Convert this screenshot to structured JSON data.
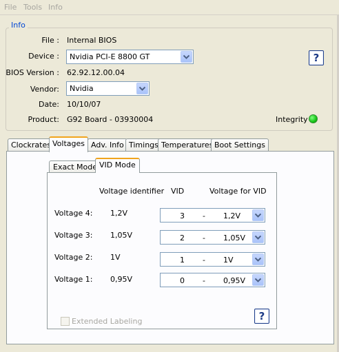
{
  "menu": [
    "File",
    "Tools",
    "Info"
  ],
  "info": {
    "title": "Info",
    "file_label": "File :",
    "file_value": "Internal BIOS",
    "device_label": "Device :",
    "device_value": "Nvidia PCI-E 8800 GT",
    "bios_version_label": "BIOS Version :",
    "bios_version_value": "62.92.12.00.04",
    "vendor_label": "Vendor:",
    "vendor_value": "Nvidia",
    "date_label": "Date:",
    "date_value": "10/10/07",
    "product_label": "Product:",
    "product_value": "G92 Board - 03930004",
    "integrity_label": "Integrity :",
    "integrity_color": "#18c418",
    "help_label": "?"
  },
  "tabs": [
    "Clockrates",
    "Voltages",
    "Adv. Info",
    "Timings",
    "Temperatures",
    "Boot Settings"
  ],
  "active_tab": "Voltages",
  "subtabs": [
    "Exact Mode",
    "VID Mode"
  ],
  "active_subtab": "VID Mode",
  "voltages": {
    "col_identifier": "Voltage identifier",
    "col_vid": "VID",
    "col_voltage": "Voltage for VID",
    "rows": [
      {
        "label": "Voltage 4:",
        "identifier": "1,2V",
        "vid": "3",
        "dash": "-",
        "voltage": "1,2V"
      },
      {
        "label": "Voltage 3:",
        "identifier": "1,05V",
        "vid": "2",
        "dash": "-",
        "voltage": "1,05V"
      },
      {
        "label": "Voltage 2:",
        "identifier": "1V",
        "vid": "1",
        "dash": "-",
        "voltage": "1V"
      },
      {
        "label": "Voltage 1:",
        "identifier": "0,95V",
        "vid": "0",
        "dash": "-",
        "voltage": "0,95V"
      }
    ],
    "extended_labeling": "Extended Labeling",
    "help_label": "?"
  }
}
